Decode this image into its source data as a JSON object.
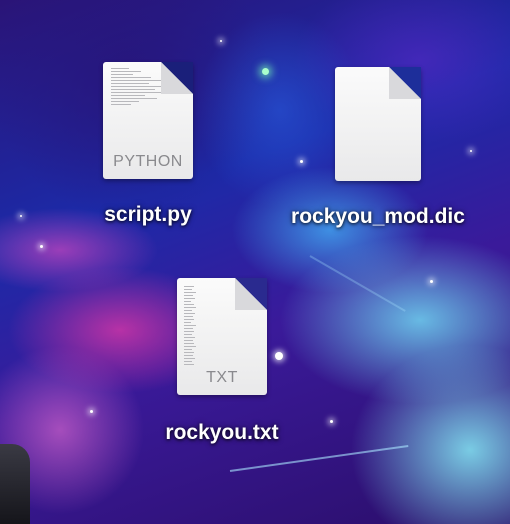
{
  "desktop": {
    "files": [
      {
        "name": "script.py",
        "badge": "PYTHON",
        "icon": "python-file-icon"
      },
      {
        "name": "rockyou_mod.dic",
        "badge": "",
        "icon": "generic-file-icon"
      },
      {
        "name": "rockyou.txt",
        "badge": "TXT",
        "icon": "text-file-icon"
      }
    ]
  },
  "colors": {
    "label": "#ffffff",
    "icon_paper": "#f4f4f5",
    "badge_text": "#8a8a8e"
  }
}
